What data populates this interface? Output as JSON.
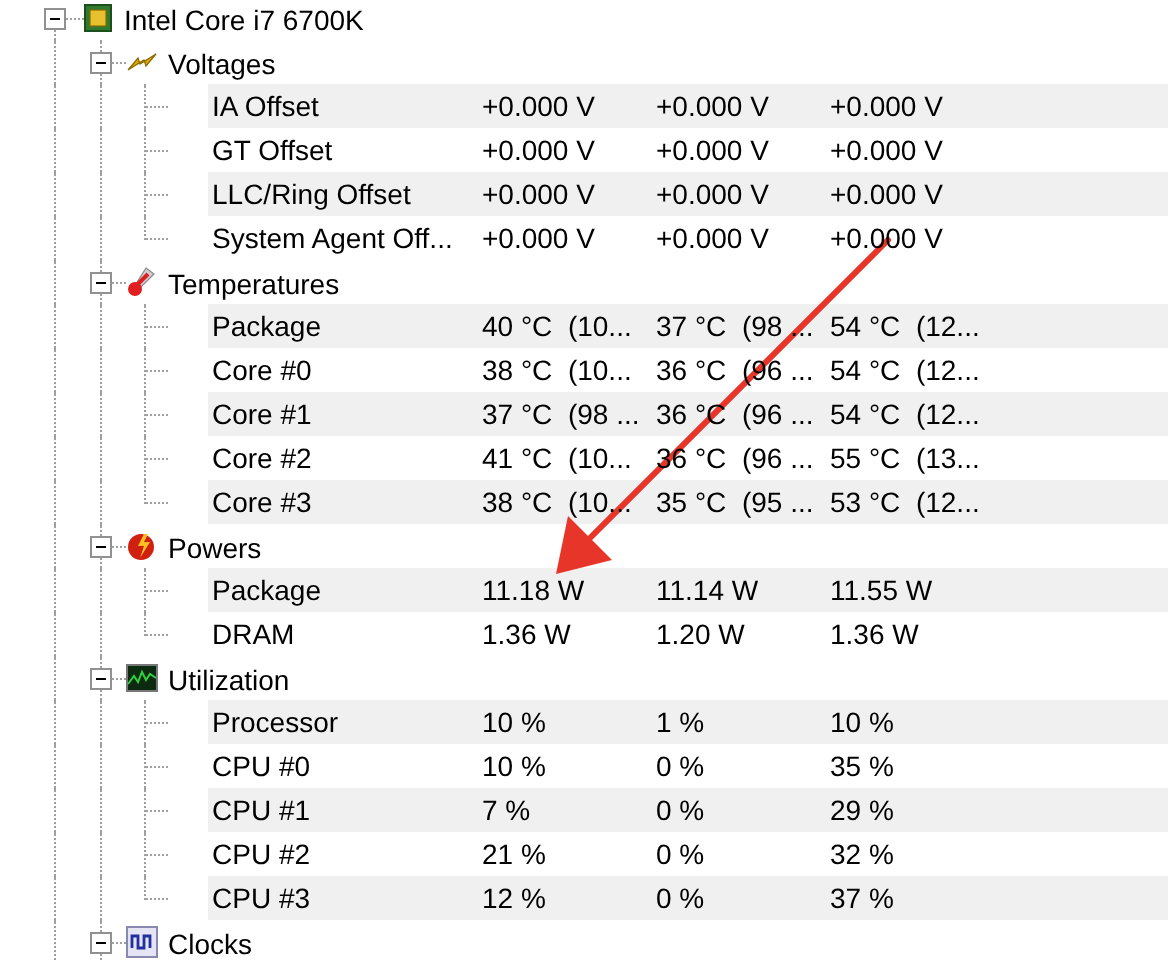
{
  "tree": {
    "label": "Intel Core i7 6700K",
    "expanded": true,
    "groups": [
      {
        "kind": "voltages",
        "label": "Voltages",
        "expanded": true,
        "rows": [
          {
            "label": "IA Offset",
            "values": [
              "+0.000 V",
              "+0.000 V",
              "+0.000 V"
            ]
          },
          {
            "label": "GT Offset",
            "values": [
              "+0.000 V",
              "+0.000 V",
              "+0.000 V"
            ]
          },
          {
            "label": "LLC/Ring Offset",
            "values": [
              "+0.000 V",
              "+0.000 V",
              "+0.000 V"
            ]
          },
          {
            "label": "System Agent Off...",
            "values": [
              "+0.000 V",
              "+0.000 V",
              "+0.000 V"
            ]
          }
        ]
      },
      {
        "kind": "temperatures",
        "label": "Temperatures",
        "expanded": true,
        "rows": [
          {
            "label": "Package",
            "values": [
              "40 °C  (10...",
              "37 °C  (98 ...",
              "54 °C  (12..."
            ]
          },
          {
            "label": "Core #0",
            "values": [
              "38 °C  (10...",
              "36 °C  (96 ...",
              "54 °C  (12..."
            ]
          },
          {
            "label": "Core #1",
            "values": [
              "37 °C  (98 ...",
              "36 °C  (96 ...",
              "54 °C  (12..."
            ]
          },
          {
            "label": "Core #2",
            "values": [
              "41 °C  (10...",
              "36 °C  (96 ...",
              "55 °C  (13..."
            ]
          },
          {
            "label": "Core #3",
            "values": [
              "38 °C  (10...",
              "35 °C  (95 ...",
              "53 °C  (12..."
            ]
          }
        ]
      },
      {
        "kind": "powers",
        "label": "Powers",
        "expanded": true,
        "rows": [
          {
            "label": "Package",
            "values": [
              "11.18 W",
              "11.14 W",
              "11.55 W"
            ]
          },
          {
            "label": "DRAM",
            "values": [
              "1.36 W",
              "1.20 W",
              "1.36 W"
            ]
          }
        ]
      },
      {
        "kind": "utilization",
        "label": "Utilization",
        "expanded": true,
        "rows": [
          {
            "label": "Processor",
            "values": [
              "10 %",
              "1 %",
              "10 %"
            ]
          },
          {
            "label": "CPU #0",
            "values": [
              "10 %",
              "0 %",
              "35 %"
            ]
          },
          {
            "label": "CPU #1",
            "values": [
              "7 %",
              "0 %",
              "29 %"
            ]
          },
          {
            "label": "CPU #2",
            "values": [
              "21 %",
              "0 %",
              "32 %"
            ]
          },
          {
            "label": "CPU #3",
            "values": [
              "12 %",
              "0 %",
              "37 %"
            ]
          }
        ]
      },
      {
        "kind": "clocks",
        "label": "Clocks",
        "expanded": true
      }
    ]
  }
}
